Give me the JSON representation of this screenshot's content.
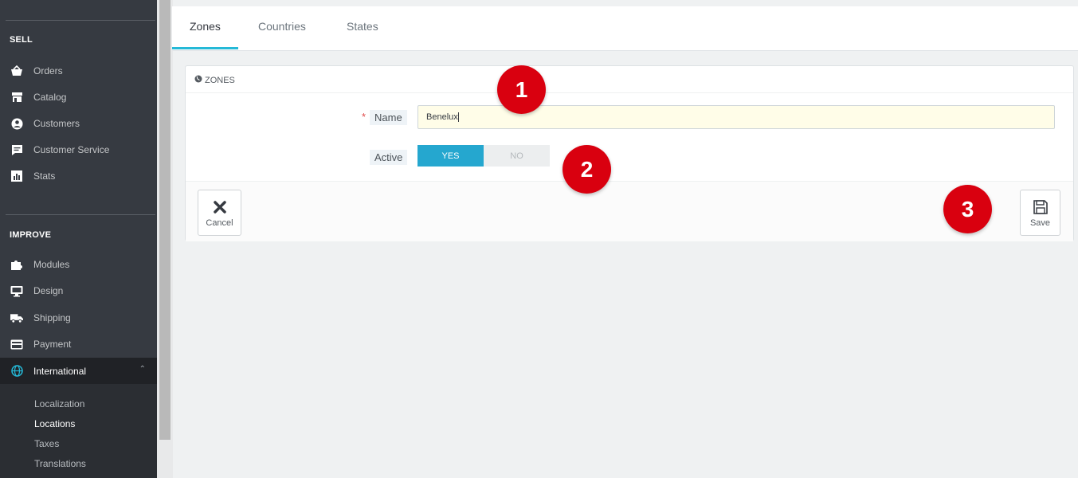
{
  "sidebar": {
    "sections": {
      "sell": "SELL",
      "improve": "IMPROVE"
    },
    "sell_items": [
      {
        "label": "Orders",
        "icon": "basket-icon"
      },
      {
        "label": "Catalog",
        "icon": "store-icon"
      },
      {
        "label": "Customers",
        "icon": "user-circle-icon"
      },
      {
        "label": "Customer Service",
        "icon": "chat-icon"
      },
      {
        "label": "Stats",
        "icon": "bar-chart-icon"
      }
    ],
    "improve_items": [
      {
        "label": "Modules",
        "icon": "puzzle-icon"
      },
      {
        "label": "Design",
        "icon": "monitor-icon"
      },
      {
        "label": "Shipping",
        "icon": "truck-icon"
      },
      {
        "label": "Payment",
        "icon": "credit-card-icon"
      },
      {
        "label": "International",
        "icon": "globe-icon",
        "active": true
      }
    ],
    "international_sub": [
      {
        "label": "Localization"
      },
      {
        "label": "Locations",
        "current": true
      },
      {
        "label": "Taxes"
      },
      {
        "label": "Translations"
      }
    ]
  },
  "tabs": [
    {
      "label": "Zones",
      "active": true
    },
    {
      "label": "Countries"
    },
    {
      "label": "States"
    }
  ],
  "panel": {
    "title": "ZONES",
    "name_label": "Name",
    "required_mark": "*",
    "name_value": "Benelux",
    "active_label": "Active",
    "toggle_yes": "YES",
    "toggle_no": "NO",
    "active_value": "YES"
  },
  "footer": {
    "cancel_label": "Cancel",
    "save_label": "Save"
  },
  "badges": [
    "1",
    "2",
    "3"
  ],
  "colors": {
    "sidebar_bg": "#363a41",
    "accent": "#25b9d7",
    "toggle_on": "#25a7cf",
    "badge": "#d9000f",
    "input_bg": "#fffde8"
  }
}
